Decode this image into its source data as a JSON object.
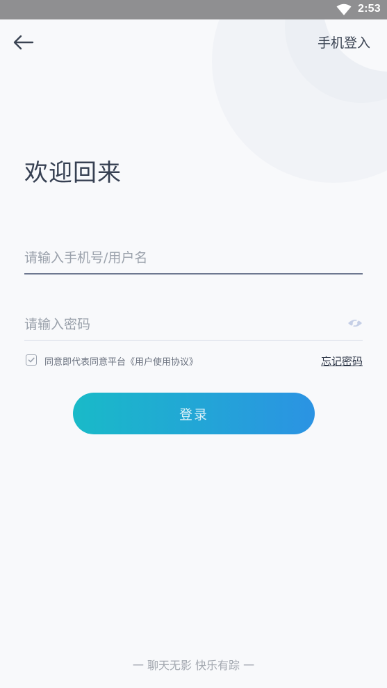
{
  "status_bar": {
    "time": "2:53",
    "wifi_icon": "wifi-icon"
  },
  "header": {
    "back_icon": "back-arrow-icon",
    "phone_login_label": "手机登入"
  },
  "page": {
    "title": "欢迎回来"
  },
  "form": {
    "username_placeholder": "请输入手机号/用户名",
    "username_value": "",
    "password_placeholder": "请输入密码",
    "password_value": "",
    "eye_icon": "eye-hidden-icon",
    "agree_text": "同意即代表同意平台《用户使用协议》",
    "agree_checked": true,
    "forgot_label": "忘记密码",
    "login_label": "登录"
  },
  "footer": {
    "slogan": "一 聊天无影 快乐有踪 一"
  },
  "colors": {
    "background": "#f8f9fb",
    "status_bar": "#8f8f91",
    "button_gradient_start": "#19bac8",
    "button_gradient_end": "#2b93e3"
  }
}
